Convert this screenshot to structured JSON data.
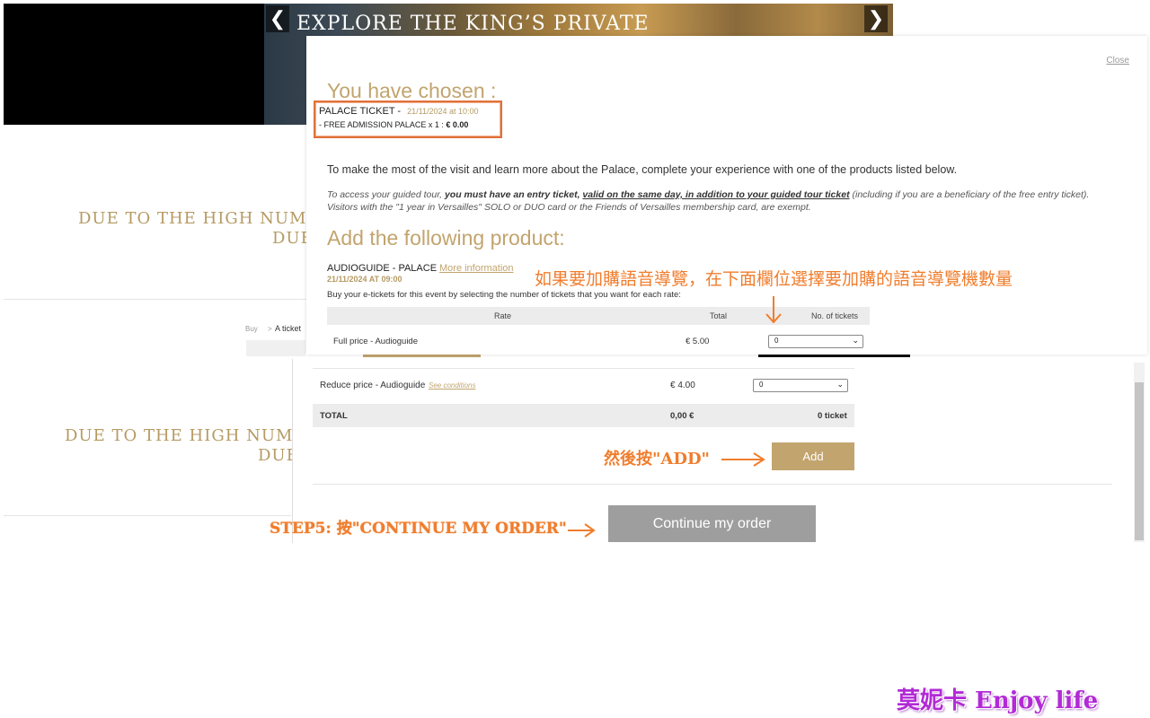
{
  "hero": {
    "title": "EXPLORE THE KING’S PRIVATE",
    "prev_arrow": "❮",
    "next_arrow": "❯"
  },
  "background": {
    "due_line_1": "DUE TO THE HIGH NUMBER C",
    "due_line_1b": "DUE",
    "due_line_2": "DUE TO THE HIGH NUMBER C",
    "due_line_2b": "DUE",
    "breadcrumb_buy": "Buy",
    "breadcrumb_sep": ">",
    "breadcrumb_ticket": "A ticket"
  },
  "modal": {
    "close_label": "Close",
    "chosen_title": "You have chosen :",
    "chosen_ticket": "PALACE TICKET -",
    "chosen_date": "21/11/2024 at 10:00",
    "chosen_detail_prefix": "- FREE ADMISSION PALACE x 1 : ",
    "chosen_detail_price": "€ 0.00",
    "intro": "To make the most of the visit and learn more about the Palace, complete your experience with one of the products listed below.",
    "note_1": "To access your guided tour, ",
    "note_2": "you must have an entry ticket, ",
    "note_3": "valid on the same day, in addition to your guided tour ticket",
    "note_4": " (including if you are a beneficiary of the free entry ticket). Visitors with the \"1 year in Versailles\" SOLO or DUO card or the Friends of Versailles membership card, are exempt.",
    "add_title": "Add the following product:",
    "product_name": "AUDIOGUIDE - PALACE",
    "more_info": "More information",
    "product_date": "21/11/2024 AT 09:00",
    "buy_text": "Buy your e-tickets for this event by selecting the number of tickets that you want for each rate:",
    "table": {
      "headers": {
        "rate": "Rate",
        "total": "Total",
        "tickets": "No. of tickets"
      },
      "rows": [
        {
          "label": "Full price - Audioguide",
          "price": "€ 5.00",
          "qty": "0"
        },
        {
          "label": "Reduce price - Audioguide",
          "conditions": "See conditions",
          "price": "€ 4.00",
          "qty": "0"
        }
      ],
      "total_label": "TOTAL",
      "total_amount": "0,00 €",
      "total_tickets": "0 ticket"
    },
    "add_button": "Add",
    "continue_button": "Continue my order"
  },
  "annotations": {
    "select_hint": "如果要加購語音導覽，在下面欄位選擇要加購的語音導覽機數量",
    "add_hint": "然後按\"ADD\"",
    "step5_hint": "STEP5: 按\"CONTINUE MY ORDER\"",
    "watermark": "莫妮卡 Enjoy life"
  },
  "colors": {
    "gold": "#c2a46e",
    "annotation_orange": "#f07d2d",
    "continue_gray": "#9e9e9e",
    "watermark_purple": "#b22ad6"
  }
}
